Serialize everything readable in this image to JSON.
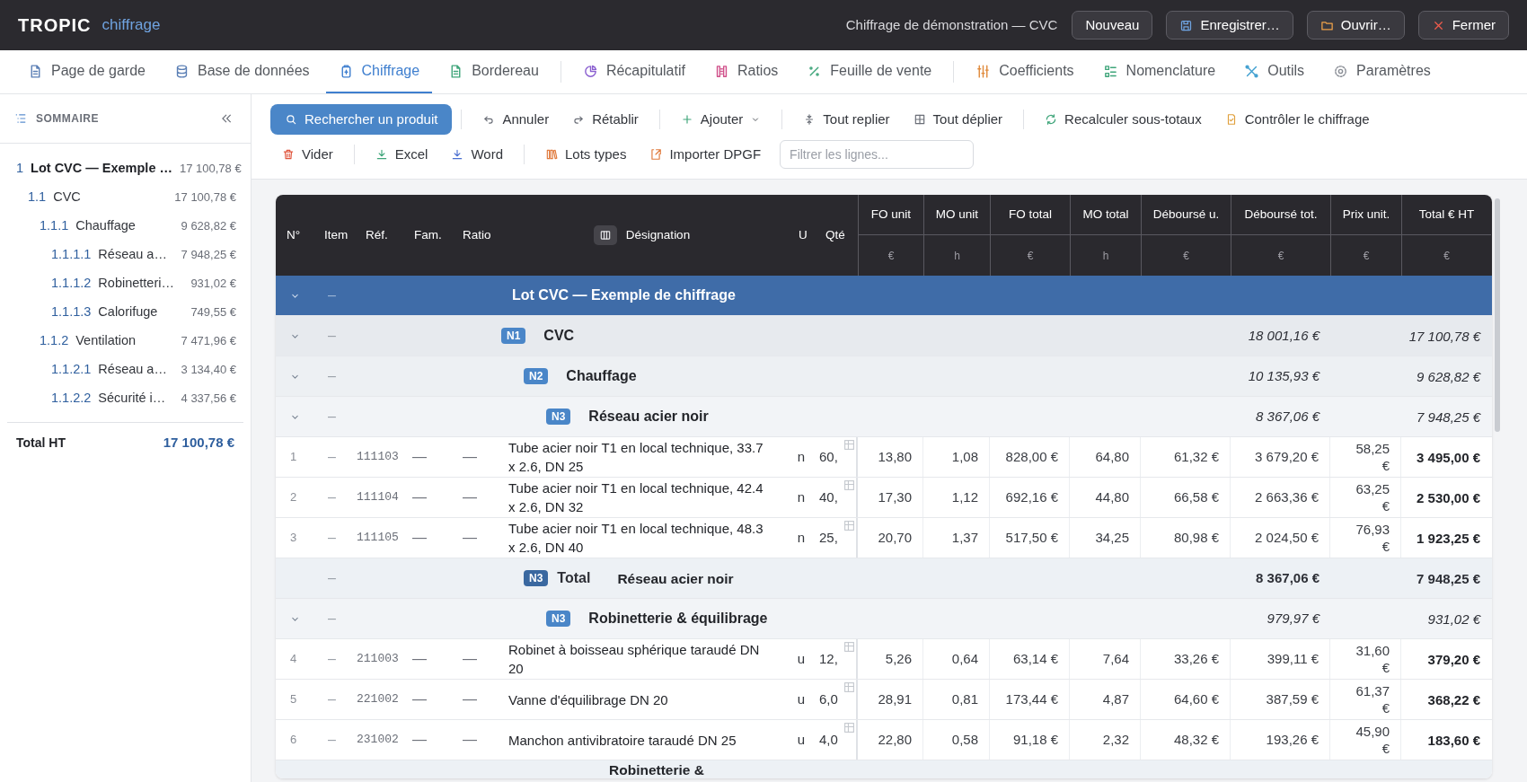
{
  "app": {
    "logo": "TROPIC",
    "module": "chiffrage",
    "document_title": "Chiffrage de démonstration — CVC",
    "buttons": [
      "Nouveau",
      "Enregistrer…",
      "Ouvrir…",
      "Fermer"
    ]
  },
  "nav": {
    "groups": [
      [
        {
          "label": "Page de garde",
          "selected": false
        },
        {
          "label": "Base de données",
          "selected": false
        },
        {
          "label": "Chiffrage",
          "selected": true
        },
        {
          "label": "Bordereau",
          "selected": false
        }
      ],
      [
        {
          "label": "Récapitulatif",
          "selected": false
        },
        {
          "label": "Ratios",
          "selected": false
        },
        {
          "label": "Feuille de vente",
          "selected": false
        }
      ],
      [
        {
          "label": "Coefficients",
          "selected": false
        },
        {
          "label": "Nomenclature",
          "selected": false
        },
        {
          "label": "Outils",
          "selected": false
        },
        {
          "label": "Paramètres",
          "selected": false
        }
      ]
    ]
  },
  "sidebar": {
    "title": "SOMMAIRE",
    "items": [
      {
        "number": "1",
        "label": "Lot CVC — Exemple …",
        "amount": "17 100,78 €",
        "children": [
          {
            "number": "1.1",
            "label": "CVC",
            "amount": "17 100,78 €",
            "children": [
              {
                "number": "1.1.1",
                "label": "Chauffage",
                "amount": "9 628,82 €",
                "children": [
                  {
                    "number": "1.1.1.1",
                    "label": "Réseau a…",
                    "amount": "7 948,25 €"
                  },
                  {
                    "number": "1.1.1.2",
                    "label": "Robinetteri…",
                    "amount": "931,02 €"
                  },
                  {
                    "number": "1.1.1.3",
                    "label": "Calorifuge",
                    "amount": "749,55 €"
                  }
                ]
              },
              {
                "number": "1.1.2",
                "label": "Ventilation",
                "amount": "7 471,96 €",
                "children": [
                  {
                    "number": "1.1.2.1",
                    "label": "Réseau a…",
                    "amount": "3 134,40 €"
                  },
                  {
                    "number": "1.1.2.2",
                    "label": "Sécurité i…",
                    "amount": "4 337,56 €"
                  }
                ]
              }
            ]
          }
        ]
      }
    ],
    "total_label": "Total HT",
    "total_value": "17 100,78 €"
  },
  "toolbar": {
    "rows": [
      [
        [
          {
            "label": "Rechercher un produit",
            "kind": "primary"
          }
        ],
        [
          {
            "label": "Annuler",
            "kind": "plain"
          },
          {
            "label": "Rétablir",
            "kind": "plain"
          }
        ],
        [
          {
            "label": "Ajouter",
            "kind": "dropdown"
          }
        ],
        [
          {
            "label": "Tout replier",
            "kind": "plain"
          },
          {
            "label": "Tout déplier",
            "kind": "plain"
          }
        ],
        [
          {
            "label": "Recalculer sous-totaux",
            "kind": "plain"
          },
          {
            "label": "Contrôler le chiffrage",
            "kind": "plain"
          }
        ]
      ],
      [
        [
          {
            "label": "Vider",
            "kind": "plain"
          }
        ],
        [
          {
            "label": "Excel",
            "kind": "plain"
          },
          {
            "label": "Word",
            "kind": "plain"
          }
        ],
        [
          {
            "label": "Lots types",
            "kind": "plain"
          },
          {
            "label": "Importer DPGF",
            "kind": "plain"
          }
        ]
      ]
    ],
    "filter": {
      "placeholder": "Filtrer les lignes..."
    }
  },
  "table": {
    "columns": [
      {
        "label": "N°"
      },
      {
        "label": "Item"
      },
      {
        "label": "Réf."
      },
      {
        "label": "Fam."
      },
      {
        "label": "Ratio"
      },
      {
        "label": "Désignation"
      },
      {
        "label": "U"
      },
      {
        "label": "Qté"
      },
      {
        "label": "FO unit",
        "unit": "€"
      },
      {
        "label": "MO unit",
        "unit": "h"
      },
      {
        "label": "FO total",
        "unit": "€"
      },
      {
        "label": "MO total",
        "unit": "h"
      },
      {
        "label": "Déboursé u.",
        "unit": "€"
      },
      {
        "label": "Déboursé tot.",
        "unit": "€"
      },
      {
        "label": "Prix unit.",
        "unit": "€"
      },
      {
        "label": "Total € HT",
        "unit": "€"
      }
    ],
    "rows": [
      {
        "kind": "group",
        "expanded": true,
        "item": "–",
        "label": "Lot CVC — Exemple de chiffrage",
        "children": [
          {
            "kind": "group",
            "badge": "N1",
            "expanded": true,
            "item": "–",
            "label": "CVC",
            "debourse_total": "18 001,16 €",
            "total_ht": "17 100,78 €",
            "children": [
              {
                "kind": "group",
                "badge": "N2",
                "expanded": true,
                "item": "–",
                "label": "Chauffage",
                "debourse_total": "10 135,93 €",
                "total_ht": "9 628,82 €",
                "children": [
                  {
                    "kind": "group",
                    "badge": "N3",
                    "expanded": true,
                    "item": "–",
                    "label": "Réseau acier noir",
                    "debourse_total": "8 367,06 €",
                    "total_ht": "7 948,25 €",
                    "children": [
                      {
                        "kind": "item",
                        "number": "1",
                        "item": "–",
                        "ref": "111103",
                        "family": "—",
                        "ratio": "—",
                        "designation": "Tube acier noir T1 en local technique, 33.7 x 2.6, DN 25",
                        "unit": "n",
                        "qty": "60,",
                        "fo_unit": "13,80",
                        "mo_unit": "1,08",
                        "fo_total": "828,00 €",
                        "mo_total": "64,80",
                        "debourse_u": "61,32 €",
                        "debourse_total": "3 679,20 €",
                        "price_unit": "58,25 €",
                        "total_ht": "3 495,00 €"
                      },
                      {
                        "kind": "item",
                        "number": "2",
                        "item": "–",
                        "ref": "111104",
                        "family": "—",
                        "ratio": "—",
                        "designation": "Tube acier noir T1 en local technique, 42.4 x 2.6, DN 32",
                        "unit": "n",
                        "qty": "40,",
                        "fo_unit": "17,30",
                        "mo_unit": "1,12",
                        "fo_total": "692,16 €",
                        "mo_total": "44,80",
                        "debourse_u": "66,58 €",
                        "debourse_total": "2 663,36 €",
                        "price_unit": "63,25 €",
                        "total_ht": "2 530,00 €"
                      },
                      {
                        "kind": "item",
                        "number": "3",
                        "item": "–",
                        "ref": "111105",
                        "family": "—",
                        "ratio": "—",
                        "designation": "Tube acier noir T1 en local technique, 48.3 x 2.6, DN 40",
                        "unit": "n",
                        "qty": "25,",
                        "fo_unit": "20,70",
                        "mo_unit": "1,37",
                        "fo_total": "517,50 €",
                        "mo_total": "34,25",
                        "debourse_u": "80,98 €",
                        "debourse_total": "2 024,50 €",
                        "price_unit": "76,93 €",
                        "total_ht": "1 923,25 €"
                      }
                    ]
                  },
                  {
                    "kind": "total",
                    "badge": "N3",
                    "item": "–",
                    "total_label": "Total",
                    "label": "Réseau acier noir",
                    "debourse_total": "8 367,06 €",
                    "total_ht": "7 948,25 €"
                  },
                  {
                    "kind": "group",
                    "badge": "N3",
                    "expanded": true,
                    "item": "–",
                    "label": "Robinetterie & équilibrage",
                    "debourse_total": "979,97 €",
                    "total_ht": "931,02 €",
                    "children": [
                      {
                        "kind": "item",
                        "number": "4",
                        "item": "–",
                        "ref": "211003",
                        "family": "—",
                        "ratio": "—",
                        "designation": "Robinet à boisseau sphérique taraudé DN 20",
                        "unit": "u",
                        "qty": "12,",
                        "fo_unit": "5,26",
                        "mo_unit": "0,64",
                        "fo_total": "63,14 €",
                        "mo_total": "7,64",
                        "debourse_u": "33,26 €",
                        "debourse_total": "399,11 €",
                        "price_unit": "31,60 €",
                        "total_ht": "379,20 €"
                      },
                      {
                        "kind": "item",
                        "number": "5",
                        "item": "–",
                        "ref": "221002",
                        "family": "—",
                        "ratio": "—",
                        "designation": "Vanne d'équilibrage DN 20",
                        "unit": "u",
                        "qty": "6,0",
                        "fo_unit": "28,91",
                        "mo_unit": "0,81",
                        "fo_total": "173,44 €",
                        "mo_total": "4,87",
                        "debourse_u": "64,60 €",
                        "debourse_total": "387,59 €",
                        "price_unit": "61,37 €",
                        "total_ht": "368,22 €"
                      },
                      {
                        "kind": "item",
                        "number": "6",
                        "item": "–",
                        "ref": "231002",
                        "family": "—",
                        "ratio": "—",
                        "designation": "Manchon antivibratoire taraudé DN 25",
                        "unit": "u",
                        "qty": "4,0",
                        "fo_unit": "22,80",
                        "mo_unit": "0,58",
                        "fo_total": "91,18 €",
                        "mo_total": "2,32",
                        "debourse_u": "48,32 €",
                        "debourse_total": "193,26 €",
                        "price_unit": "45,90 €",
                        "total_ht": "183,60 €"
                      }
                    ]
                  },
                  {
                    "kind": "total",
                    "label": "Robinetterie &"
                  }
                ]
              }
            ]
          }
        ]
      }
    ]
  }
}
